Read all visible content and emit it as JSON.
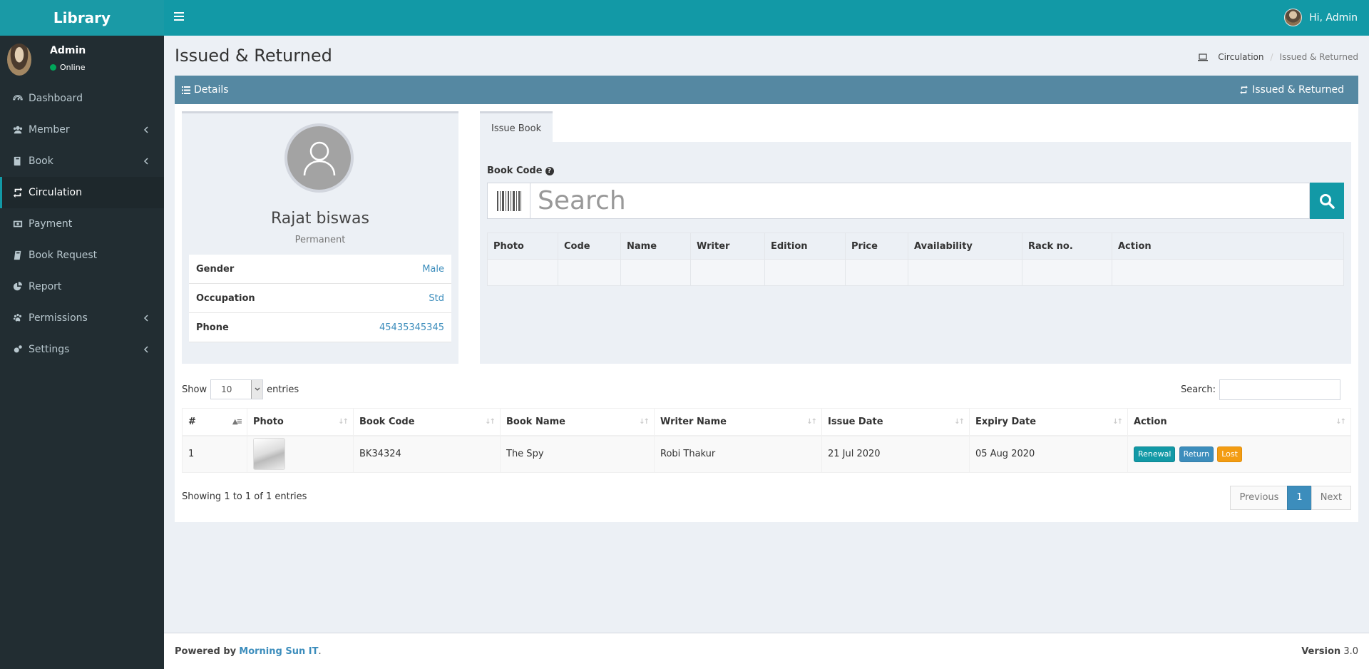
{
  "header": {
    "logo": "Library",
    "greeting": "Hi, Admin"
  },
  "sidebar": {
    "user": {
      "name": "Admin",
      "status": "Online"
    },
    "items": [
      {
        "label": "Dashboard",
        "icon": "dashboard-icon",
        "has_children": false,
        "active": false
      },
      {
        "label": "Member",
        "icon": "users-icon",
        "has_children": true,
        "active": false
      },
      {
        "label": "Book",
        "icon": "book-icon",
        "has_children": true,
        "active": false
      },
      {
        "label": "Circulation",
        "icon": "exchange-icon",
        "has_children": false,
        "active": true
      },
      {
        "label": "Payment",
        "icon": "money-icon",
        "has_children": false,
        "active": false
      },
      {
        "label": "Book Request",
        "icon": "book-request-icon",
        "has_children": false,
        "active": false
      },
      {
        "label": "Report",
        "icon": "pie-chart-icon",
        "has_children": false,
        "active": false
      },
      {
        "label": "Permissions",
        "icon": "paw-icon",
        "has_children": true,
        "active": false
      },
      {
        "label": "Settings",
        "icon": "cogs-icon",
        "has_children": true,
        "active": false
      }
    ]
  },
  "page": {
    "title": "Issued & Returned",
    "breadcrumb": {
      "section": "Circulation",
      "current": "Issued & Returned"
    }
  },
  "box": {
    "header_left": "Details",
    "header_right": "Issued & Returned"
  },
  "member": {
    "name": "Rajat biswas",
    "type": "Permanent",
    "fields": [
      {
        "label": "Gender",
        "value": "Male"
      },
      {
        "label": "Occupation",
        "value": "Std"
      },
      {
        "label": "Phone",
        "value": "45435345345"
      }
    ]
  },
  "issue": {
    "tab_label": "Issue Book",
    "book_code_label": "Book Code",
    "search_placeholder": "Search",
    "columns": [
      "Photo",
      "Code",
      "Name",
      "Writer",
      "Edition",
      "Price",
      "Availability",
      "Rack no.",
      "Action"
    ]
  },
  "datatable": {
    "show_label": "Show",
    "entries_label": "entries",
    "page_length": "10",
    "search_label": "Search:",
    "columns": [
      "#",
      "Photo",
      "Book Code",
      "Book Name",
      "Writer Name",
      "Issue Date",
      "Expiry Date",
      "Action"
    ],
    "rows": [
      {
        "num": "1",
        "book_code": "BK34324",
        "book_name": "The Spy",
        "writer": "Robi Thakur",
        "issue_date": "21 Jul 2020",
        "expiry_date": "05 Aug 2020"
      }
    ],
    "action_buttons": {
      "renewal": "Renewal",
      "return": "Return",
      "lost": "Lost"
    },
    "info": "Showing 1 to 1 of 1 entries",
    "pagination": {
      "previous": "Previous",
      "current": "1",
      "next": "Next"
    }
  },
  "footer": {
    "powered_by": "Powered by",
    "company": "Morning Sun IT",
    "period": ".",
    "version_label": "Version",
    "version": "3.0"
  },
  "colors": {
    "header": "#1299a6",
    "sidebar": "#222d32",
    "box_header": "#5588a2",
    "link": "#3c8dbc",
    "warning": "#f39c12"
  }
}
